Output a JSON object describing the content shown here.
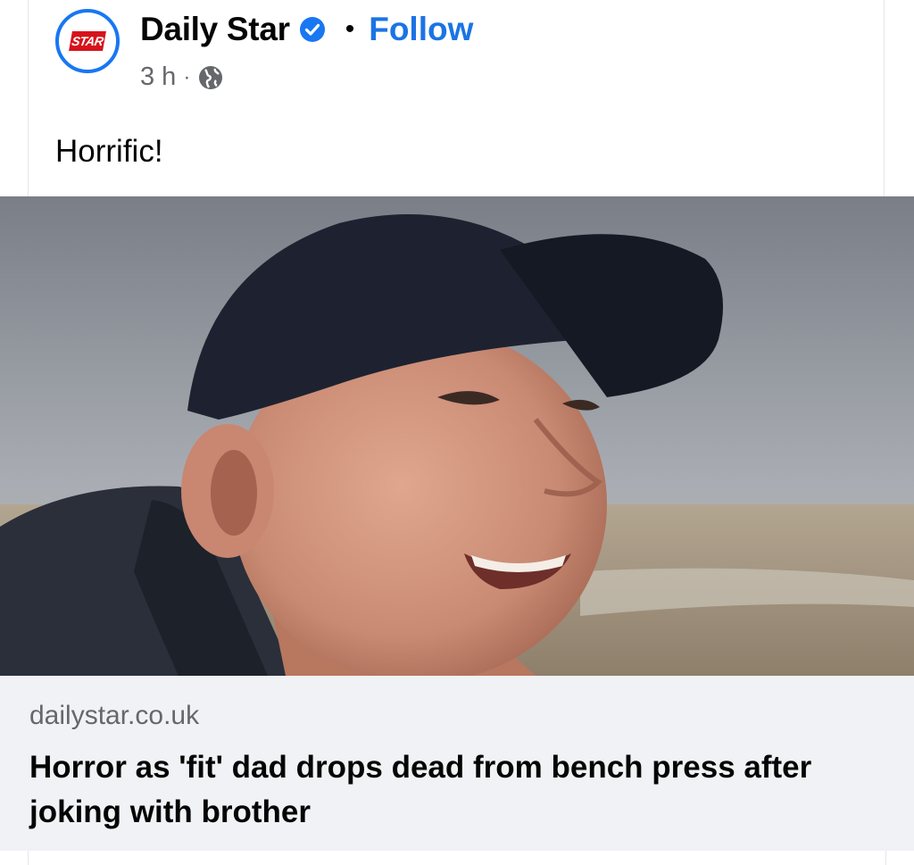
{
  "post": {
    "page_name": "Daily Star",
    "follow_label": "Follow",
    "separator": "•",
    "time": "3 h",
    "meta_dot": "·",
    "text": "Horrific!",
    "logo_text": "STAR"
  },
  "link_preview": {
    "domain": "dailystar.co.uk",
    "headline": "Horror as 'fit' dad drops dead from bench press after joking with brother"
  },
  "icons": {
    "verified": "verified-badge-icon",
    "audience": "globe-icon"
  },
  "colors": {
    "accent": "#1877f2",
    "follow": "#1b74e4",
    "brand_red": "#d6131b",
    "meta_gray": "#65676b",
    "card_bg": "#f0f2f5"
  }
}
